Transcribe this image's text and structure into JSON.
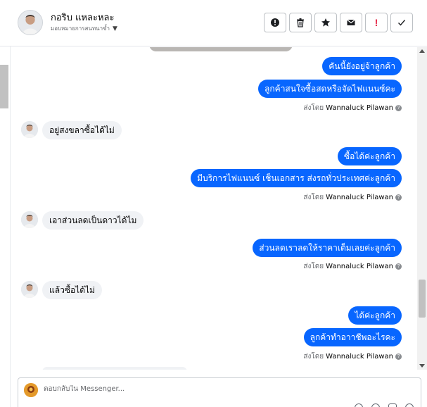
{
  "header": {
    "contact_name": "กอริบ แหละหละ",
    "contact_subtitle": "มอบหมายการสนทนาซ้ำ",
    "caret_icon": "chevron-down-icon"
  },
  "toolbar": {
    "buttons": [
      {
        "name": "report-spam-button",
        "icon": "alert-circle-icon"
      },
      {
        "name": "delete-button",
        "icon": "trash-icon"
      },
      {
        "name": "star-button",
        "icon": "star-icon"
      },
      {
        "name": "mark-unread-button",
        "icon": "envelope-icon"
      },
      {
        "name": "follow-up-button",
        "icon": "exclamation-icon",
        "label": "!"
      },
      {
        "name": "mark-done-button",
        "icon": "check-icon"
      }
    ],
    "accent_color": "#e41e3f"
  },
  "colors": {
    "outgoing_bubble": "#0866ff",
    "incoming_bubble": "#f0f2f5"
  },
  "messages": {
    "m1": "คันนี้ยังอยู่จ้าลูกค้า",
    "m2": "ลูกค้าสนใจซื้อสดหรือจัดไฟแนนซ์คะ",
    "m3": "อยู่สงขลาซื้อได้ไม่",
    "m4": "ซื้อได้ค่ะลูกค้า",
    "m5": "มีบริการไฟแนนซ์ เช็นเอกสาร ส่งรถทั่วประเทศค่ะลูกค้า",
    "m6": "เอาส่วนลดเป็นดาวได้ไม",
    "m7": "ส่วนลดเราลดให้ราคาเต็มเลยค่ะลูกค้า",
    "m8": "แล้วซื้อได้ไม่",
    "m9": "ได้ค่ะลูกค้า",
    "m10": "ลูกค้าทำอาาชีพอะไรคะ"
  },
  "sent_by": {
    "prefix": "ส่งโดย",
    "agent": "Wannaluck Pilawan",
    "info_icon": "?"
  },
  "composer": {
    "placeholder": "ตอบกลับใน Messenger..."
  }
}
